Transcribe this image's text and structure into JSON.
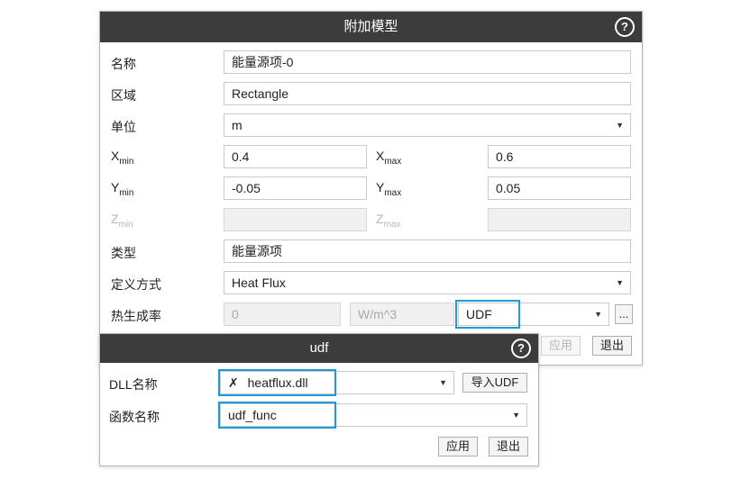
{
  "main_dialog": {
    "title": "附加模型",
    "help": "?",
    "name_label": "名称",
    "name_value": "能量源项-0",
    "region_label": "区域",
    "region_value": "Rectangle",
    "unit_label": "单位",
    "unit_value": "m",
    "xmin_label": "X",
    "xmin_sub": "min",
    "xmin_value": "0.4",
    "xmax_label": "X",
    "xmax_sub": "max",
    "xmax_value": "0.6",
    "ymin_label": "Y",
    "ymin_sub": "min",
    "ymin_value": "-0.05",
    "ymax_label": "Y",
    "ymax_sub": "max",
    "ymax_value": "0.05",
    "zmin_label": "Z",
    "zmin_sub": "min",
    "zmin_value": "",
    "zmax_label": "Z",
    "zmax_sub": "max",
    "zmax_value": "",
    "type_label": "类型",
    "type_value": "能量源项",
    "define_label": "定义方式",
    "define_value": "Heat Flux",
    "heat_label": "热生成率",
    "heat_value": "0",
    "heat_unit": "W/m^3",
    "heat_method": "UDF",
    "browse_label": "...",
    "apply_label": "应用",
    "exit_label": "退出"
  },
  "udf_dialog": {
    "title": "udf",
    "help": "?",
    "dll_label": "DLL名称",
    "dll_icon_glyph": "✗",
    "dll_value": "heatflux.dll",
    "import_label": "导入UDF",
    "func_label": "函数名称",
    "func_value": "udf_func",
    "apply_label": "应用",
    "exit_label": "退出"
  },
  "arrow_glyph": "▼",
  "colors": {
    "titlebar": "#3c3c3c",
    "highlight": "#1e9bd7"
  }
}
